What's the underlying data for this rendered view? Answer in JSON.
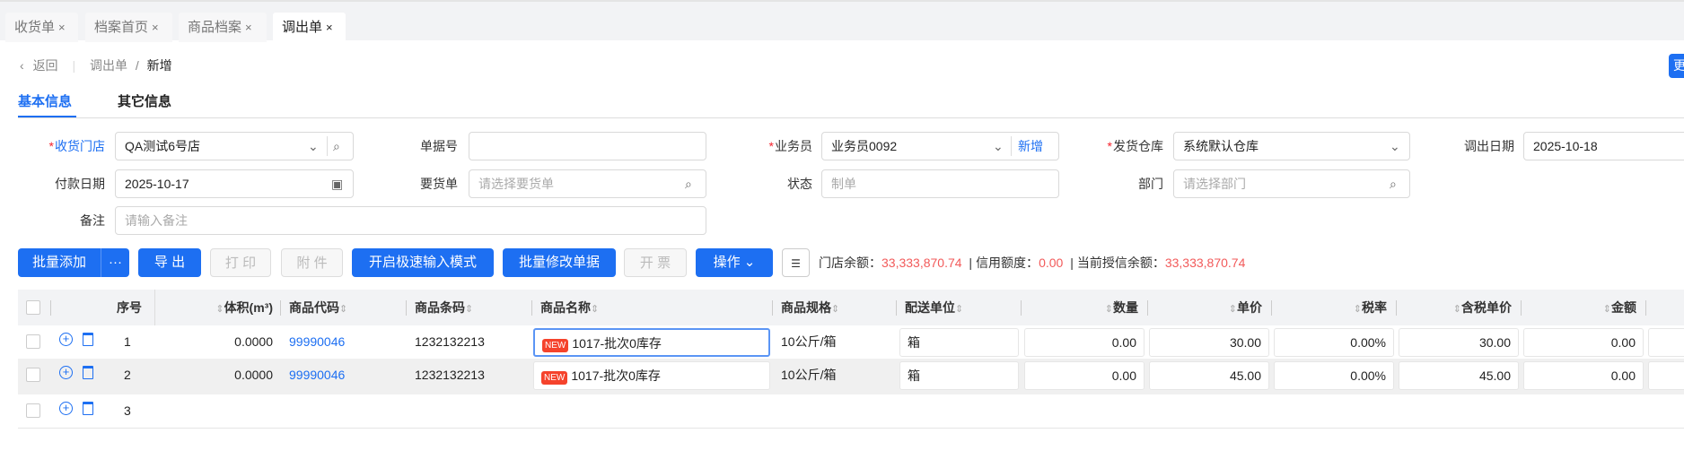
{
  "tabs": [
    {
      "label": "收货单",
      "close": "×"
    },
    {
      "label": "档案首页",
      "close": "×"
    },
    {
      "label": "商品档案",
      "close": "×"
    },
    {
      "label": "调出单",
      "close": "×",
      "active": true
    }
  ],
  "breadcrumb": {
    "back": "返回",
    "parent": "调出单",
    "sep": "/",
    "current": "新增"
  },
  "top_right_button": "更",
  "subtabs": [
    "基本信息",
    "其它信息"
  ],
  "form": {
    "store": {
      "label": "收货门店",
      "value": "QA测试6号店"
    },
    "doc_no": {
      "label": "单据号",
      "value": ""
    },
    "salesman": {
      "label": "业务员",
      "value": "业务员0092",
      "add": "新增"
    },
    "warehouse": {
      "label": "发货仓库",
      "value": "系统默认仓库"
    },
    "out_date": {
      "label": "调出日期",
      "value": "2025-10-18"
    },
    "pay_date": {
      "label": "付款日期",
      "value": "2025-10-17"
    },
    "request": {
      "label": "要货单",
      "placeholder": "请选择要货单"
    },
    "status": {
      "label": "状态",
      "value": "制单"
    },
    "dept": {
      "label": "部门",
      "placeholder": "请选择部门"
    },
    "remark": {
      "label": "备注",
      "placeholder": "请输入备注"
    }
  },
  "toolbar": {
    "batch_add": "批量添加",
    "more": "···",
    "export": "导 出",
    "print": "打 印",
    "attach": "附 件",
    "fast_mode": "开启极速输入模式",
    "batch_edit": "批量修改单据",
    "invoice": "开 票",
    "ops": "操作"
  },
  "balance": {
    "store_label": "门店余额：",
    "store_value": "33,333,870.74",
    "credit_label": "信用额度：",
    "credit_value": "0.00",
    "avail_label": "当前授信余额：",
    "avail_value": "33,333,870.74",
    "sep": "|"
  },
  "colors": {
    "primary": "#1d6ff2",
    "amount": "#f25a5a"
  },
  "table": {
    "headers": {
      "seq": "序号",
      "volume": "体积(m³)",
      "code": "商品代码",
      "barcode": "商品条码",
      "name": "商品名称",
      "spec": "商品规格",
      "unit": "配送单位",
      "qty": "数量",
      "price": "单价",
      "tax": "税率",
      "tax_price": "含税单价",
      "amount": "金额"
    },
    "badge": "NEW",
    "rows": [
      {
        "seq": "1",
        "volume": "0.0000",
        "code": "99990046",
        "barcode": "1232132213",
        "name": "1017-批次0库存",
        "spec": "10公斤/箱",
        "unit": "箱",
        "qty": "0.00",
        "price": "30.00",
        "tax": "0.00%",
        "tax_price": "30.00",
        "amount": "0.00"
      },
      {
        "seq": "2",
        "volume": "0.0000",
        "code": "99990046",
        "barcode": "1232132213",
        "name": "1017-批次0库存",
        "spec": "10公斤/箱",
        "unit": "箱",
        "qty": "0.00",
        "price": "45.00",
        "tax": "0.00%",
        "tax_price": "45.00",
        "amount": "0.00"
      },
      {
        "seq": "3"
      }
    ]
  }
}
